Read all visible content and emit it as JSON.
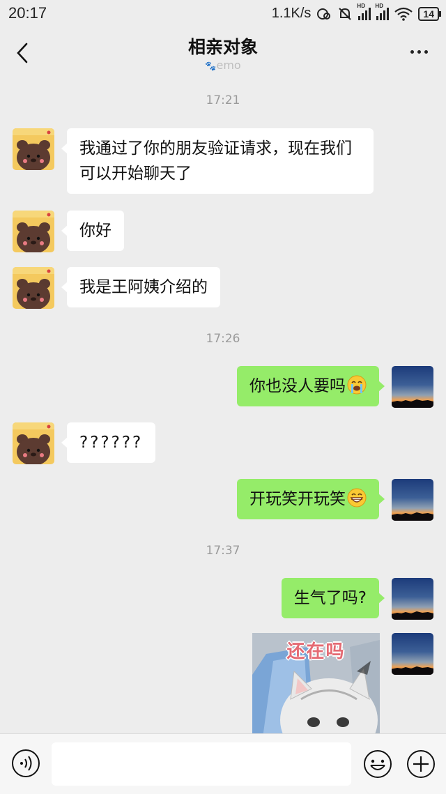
{
  "status_bar": {
    "time": "20:17",
    "network_speed": "1.1K/s",
    "signal_label": "HD",
    "battery": "14"
  },
  "header": {
    "back_icon": "chevron-left-icon",
    "title": "相亲对象",
    "subtitle": "emo",
    "more_icon": "more-dots-icon"
  },
  "messages": [
    {
      "type": "time",
      "text": "17:21"
    },
    {
      "type": "in",
      "text": "我通过了你的朋友验证请求，现在我们可以开始聊天了"
    },
    {
      "type": "in",
      "text": "你好"
    },
    {
      "type": "in",
      "text": "我是王阿姨介绍的"
    },
    {
      "type": "time",
      "text": "17:26"
    },
    {
      "type": "out",
      "text": "你也没人要吗",
      "emoji": "crying-face-icon"
    },
    {
      "type": "in",
      "text": "??????"
    },
    {
      "type": "out",
      "text": "开玩笑开玩笑",
      "emoji": "grinning-face-icon"
    },
    {
      "type": "time",
      "text": "17:37"
    },
    {
      "type": "out",
      "text": "生气了吗?"
    },
    {
      "type": "out-sticker",
      "caption": "还在吗"
    }
  ],
  "input_bar": {
    "voice_icon": "voice-icon",
    "placeholder": "",
    "emoji_icon": "emoji-icon",
    "plus_icon": "plus-icon"
  },
  "colors": {
    "background": "#ededed",
    "outgoing_bubble": "#95ec69",
    "incoming_bubble": "#ffffff",
    "timestamp": "#9a9a9a"
  }
}
